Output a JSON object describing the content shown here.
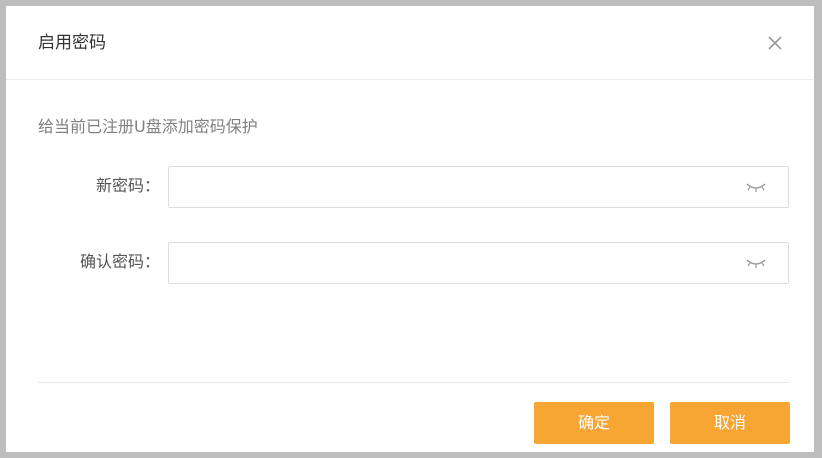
{
  "dialog": {
    "title": "启用密码",
    "description": "给当前已注册U盘添加密码保护",
    "new_password": {
      "label": "新密码：",
      "value": "",
      "icon": "eye-closed-icon"
    },
    "confirm_password": {
      "label": "确认密码：",
      "value": "",
      "icon": "eye-closed-icon"
    },
    "buttons": {
      "ok": "确定",
      "cancel": "取消"
    },
    "colors": {
      "accent": "#f7a533",
      "border": "#dddddd",
      "text": "#333333",
      "muted": "#808080"
    }
  }
}
